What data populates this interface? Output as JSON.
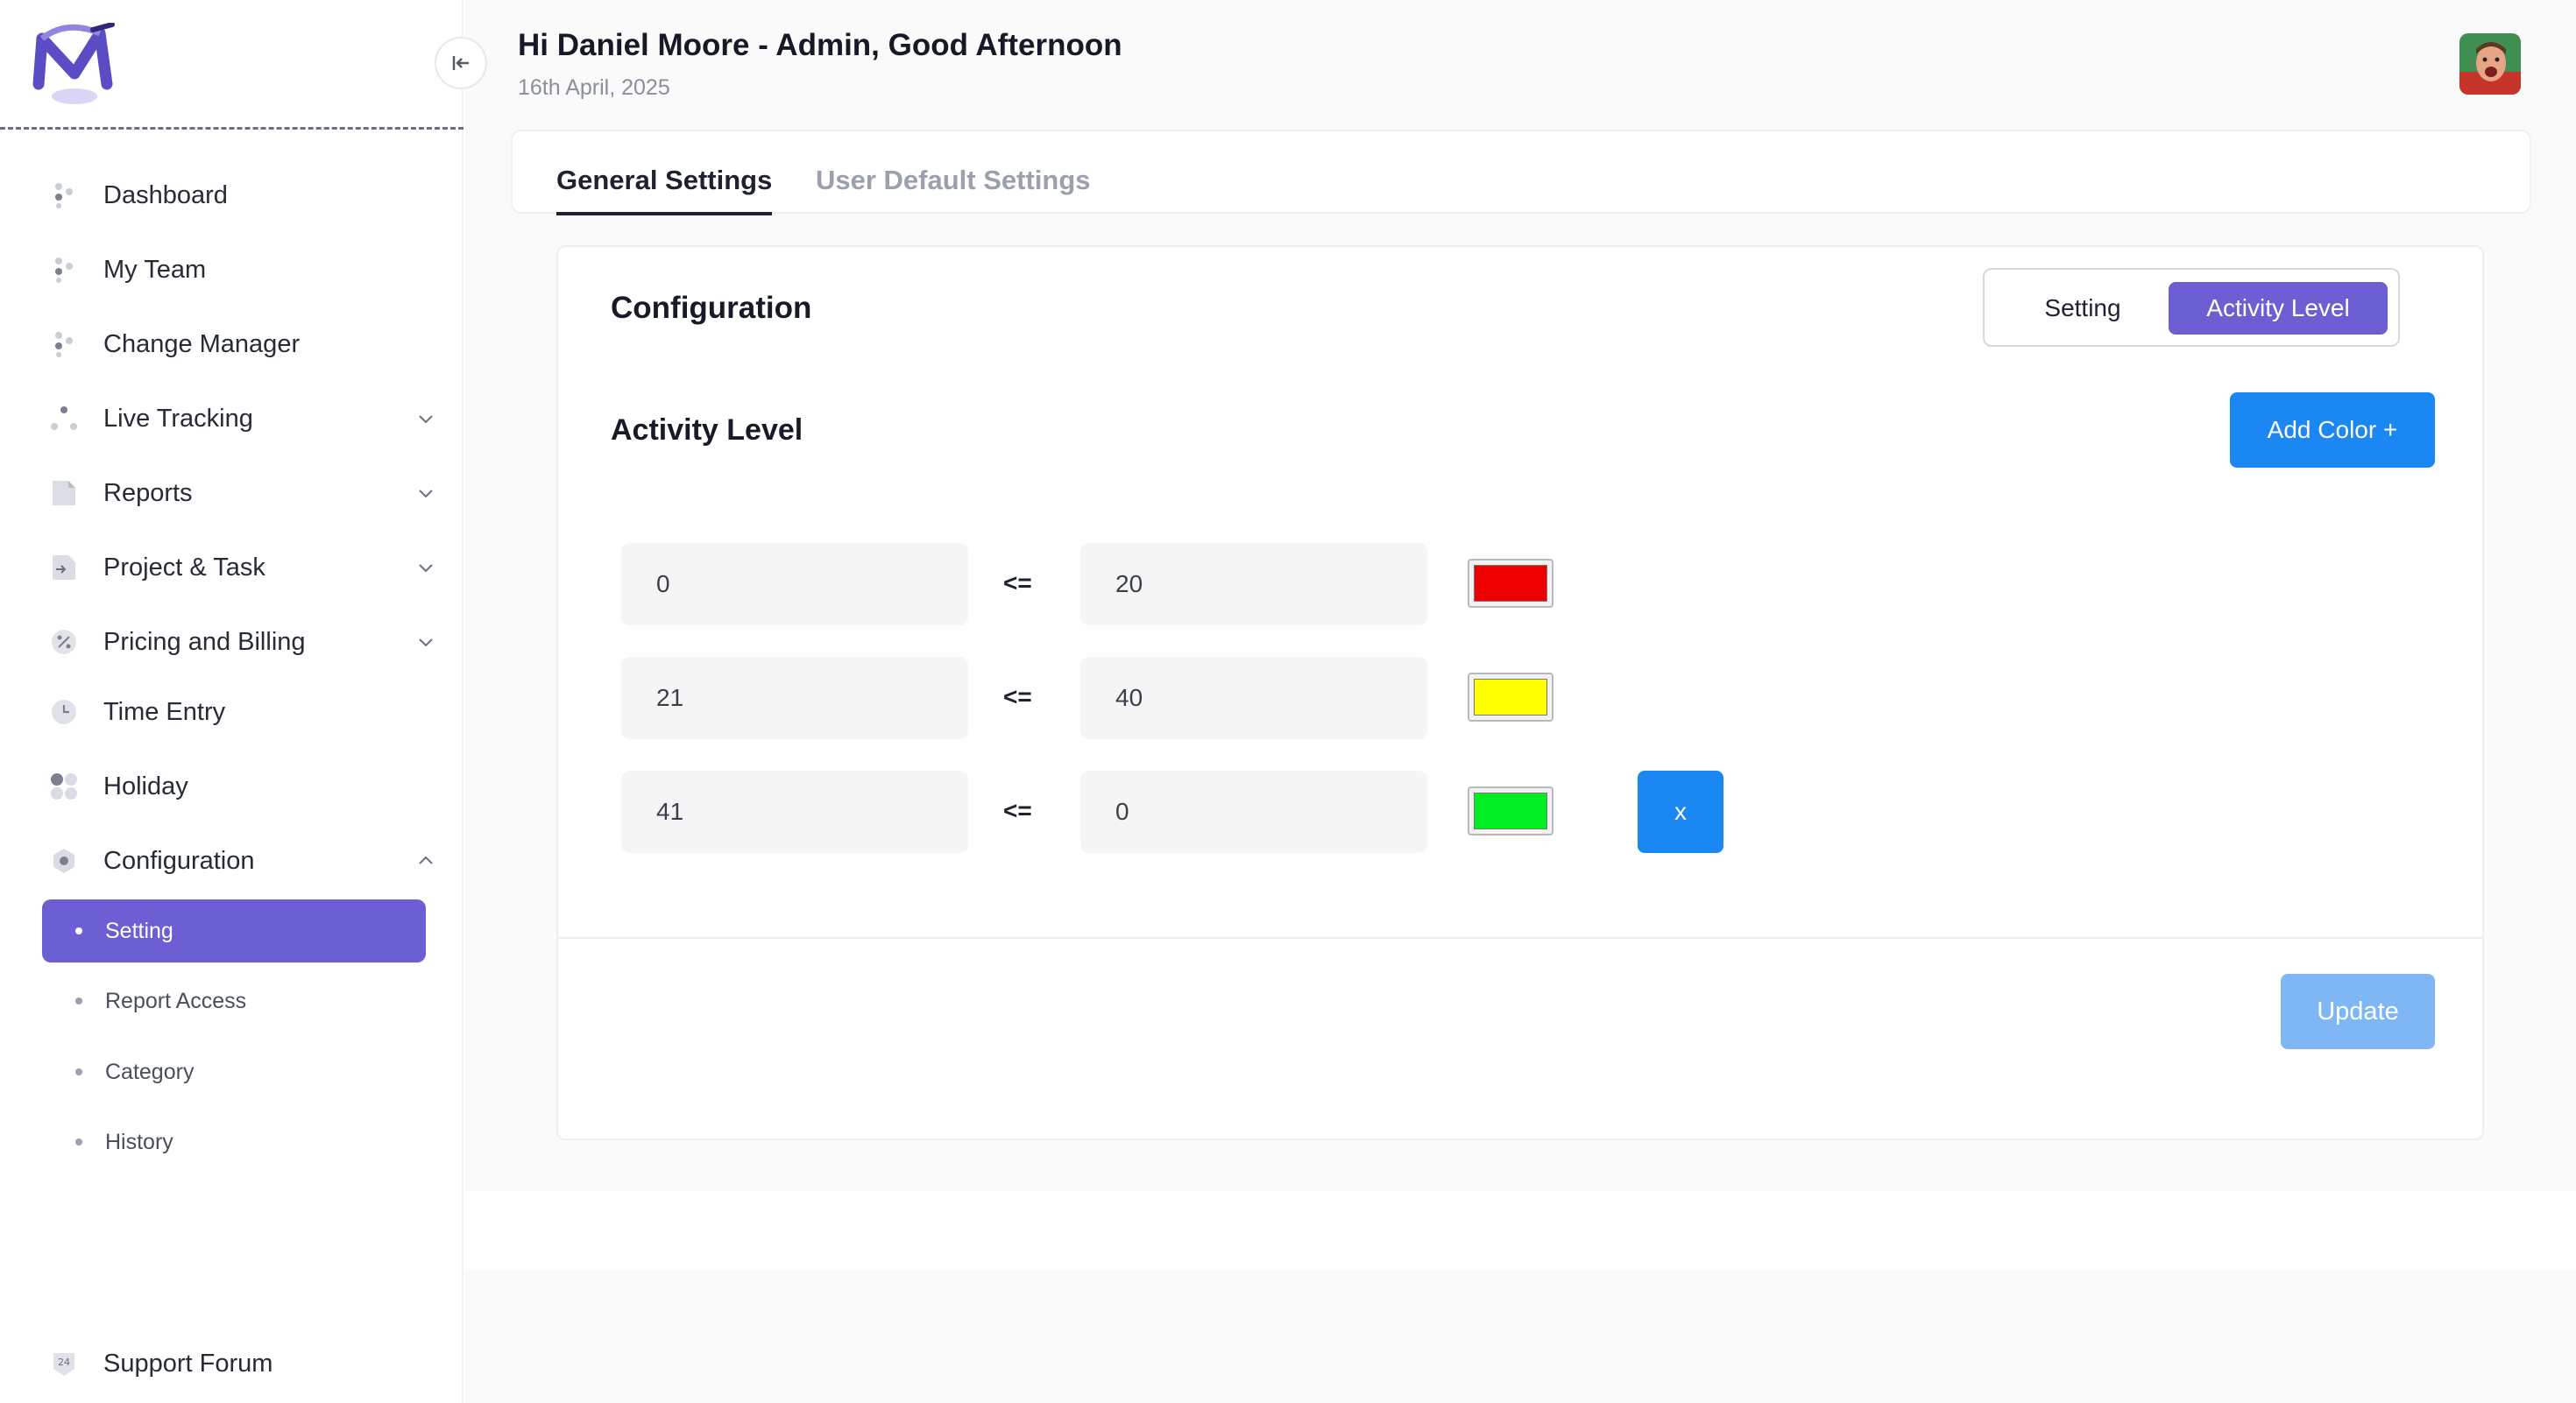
{
  "app": {
    "greeting": "Hi Daniel Moore - Admin, Good Afternoon",
    "date": "16th April, 2025"
  },
  "sidebar": {
    "items": [
      {
        "label": "Dashboard",
        "icon": "dashboard-icon"
      },
      {
        "label": "My Team",
        "icon": "team-icon"
      },
      {
        "label": "Change Manager",
        "icon": "change-manager-icon"
      },
      {
        "label": "Live Tracking",
        "icon": "tracking-icon",
        "expandable": true
      },
      {
        "label": "Reports",
        "icon": "reports-icon",
        "expandable": true
      },
      {
        "label": "Project & Task",
        "icon": "project-icon",
        "expandable": true
      },
      {
        "label": "Pricing and Billing",
        "icon": "pricing-icon",
        "expandable": true
      },
      {
        "label": "Time Entry",
        "icon": "clock-icon"
      },
      {
        "label": "Holiday",
        "icon": "holiday-icon"
      },
      {
        "label": "Configuration",
        "icon": "configuration-icon",
        "expanded": true
      }
    ],
    "subitems": [
      {
        "label": "Setting",
        "active": true
      },
      {
        "label": "Report Access"
      },
      {
        "label": "Category"
      },
      {
        "label": "History"
      }
    ],
    "support": {
      "label": "Support Forum",
      "icon": "support-24-icon",
      "badge": "24"
    }
  },
  "tabs": [
    {
      "label": "General Settings",
      "active": true
    },
    {
      "label": "User Default Settings",
      "active": false
    }
  ],
  "config": {
    "title": "Configuration",
    "toggle": {
      "setting": "Setting",
      "activity": "Activity Level",
      "selected": "Activity Level"
    },
    "section_title": "Activity Level",
    "add_color_label": "Add Color +",
    "operator": "<=",
    "levels": [
      {
        "from": "0",
        "to": "20",
        "color": "#ee0000"
      },
      {
        "from": "21",
        "to": "40",
        "color": "#ffff00"
      },
      {
        "from": "41",
        "to": "0",
        "color": "#00ee22",
        "removable": true
      }
    ],
    "remove_label": "x",
    "update_label": "Update"
  },
  "colors": {
    "accent": "#6c5fd4",
    "primary_button": "#1a87f2",
    "disabled_button": "#7fb7f5"
  }
}
